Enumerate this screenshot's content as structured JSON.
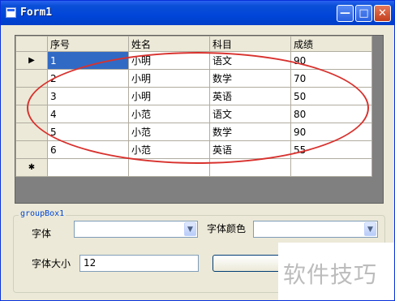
{
  "window": {
    "title": "Form1",
    "minimize_glyph": "—",
    "maximize_glyph": "□",
    "close_glyph": "✕"
  },
  "grid": {
    "columns": [
      "序号",
      "姓名",
      "科目",
      "成绩"
    ],
    "rows": [
      [
        "1",
        "小明",
        "语文",
        "90"
      ],
      [
        "2",
        "小明",
        "数学",
        "70"
      ],
      [
        "3",
        "小明",
        "英语",
        "50"
      ],
      [
        "4",
        "小范",
        "语文",
        "80"
      ],
      [
        "5",
        "小范",
        "数学",
        "90"
      ],
      [
        "6",
        "小范",
        "英语",
        "55"
      ]
    ],
    "current_row_glyph": "▶",
    "new_row_glyph": "✱"
  },
  "groupbox": {
    "title": "groupBox1",
    "font_label": "字体",
    "font_value": "",
    "font_color_label": "字体颜色",
    "font_color_value": "",
    "font_size_label": "字体大小",
    "font_size_value": "12",
    "button_label": ""
  },
  "watermark": "软件技巧",
  "colors": {
    "title_bar": "#0a4fd6",
    "selection": "#316ac5",
    "annotation_ellipse": "#d8322e",
    "group_title": "#0046d5"
  }
}
